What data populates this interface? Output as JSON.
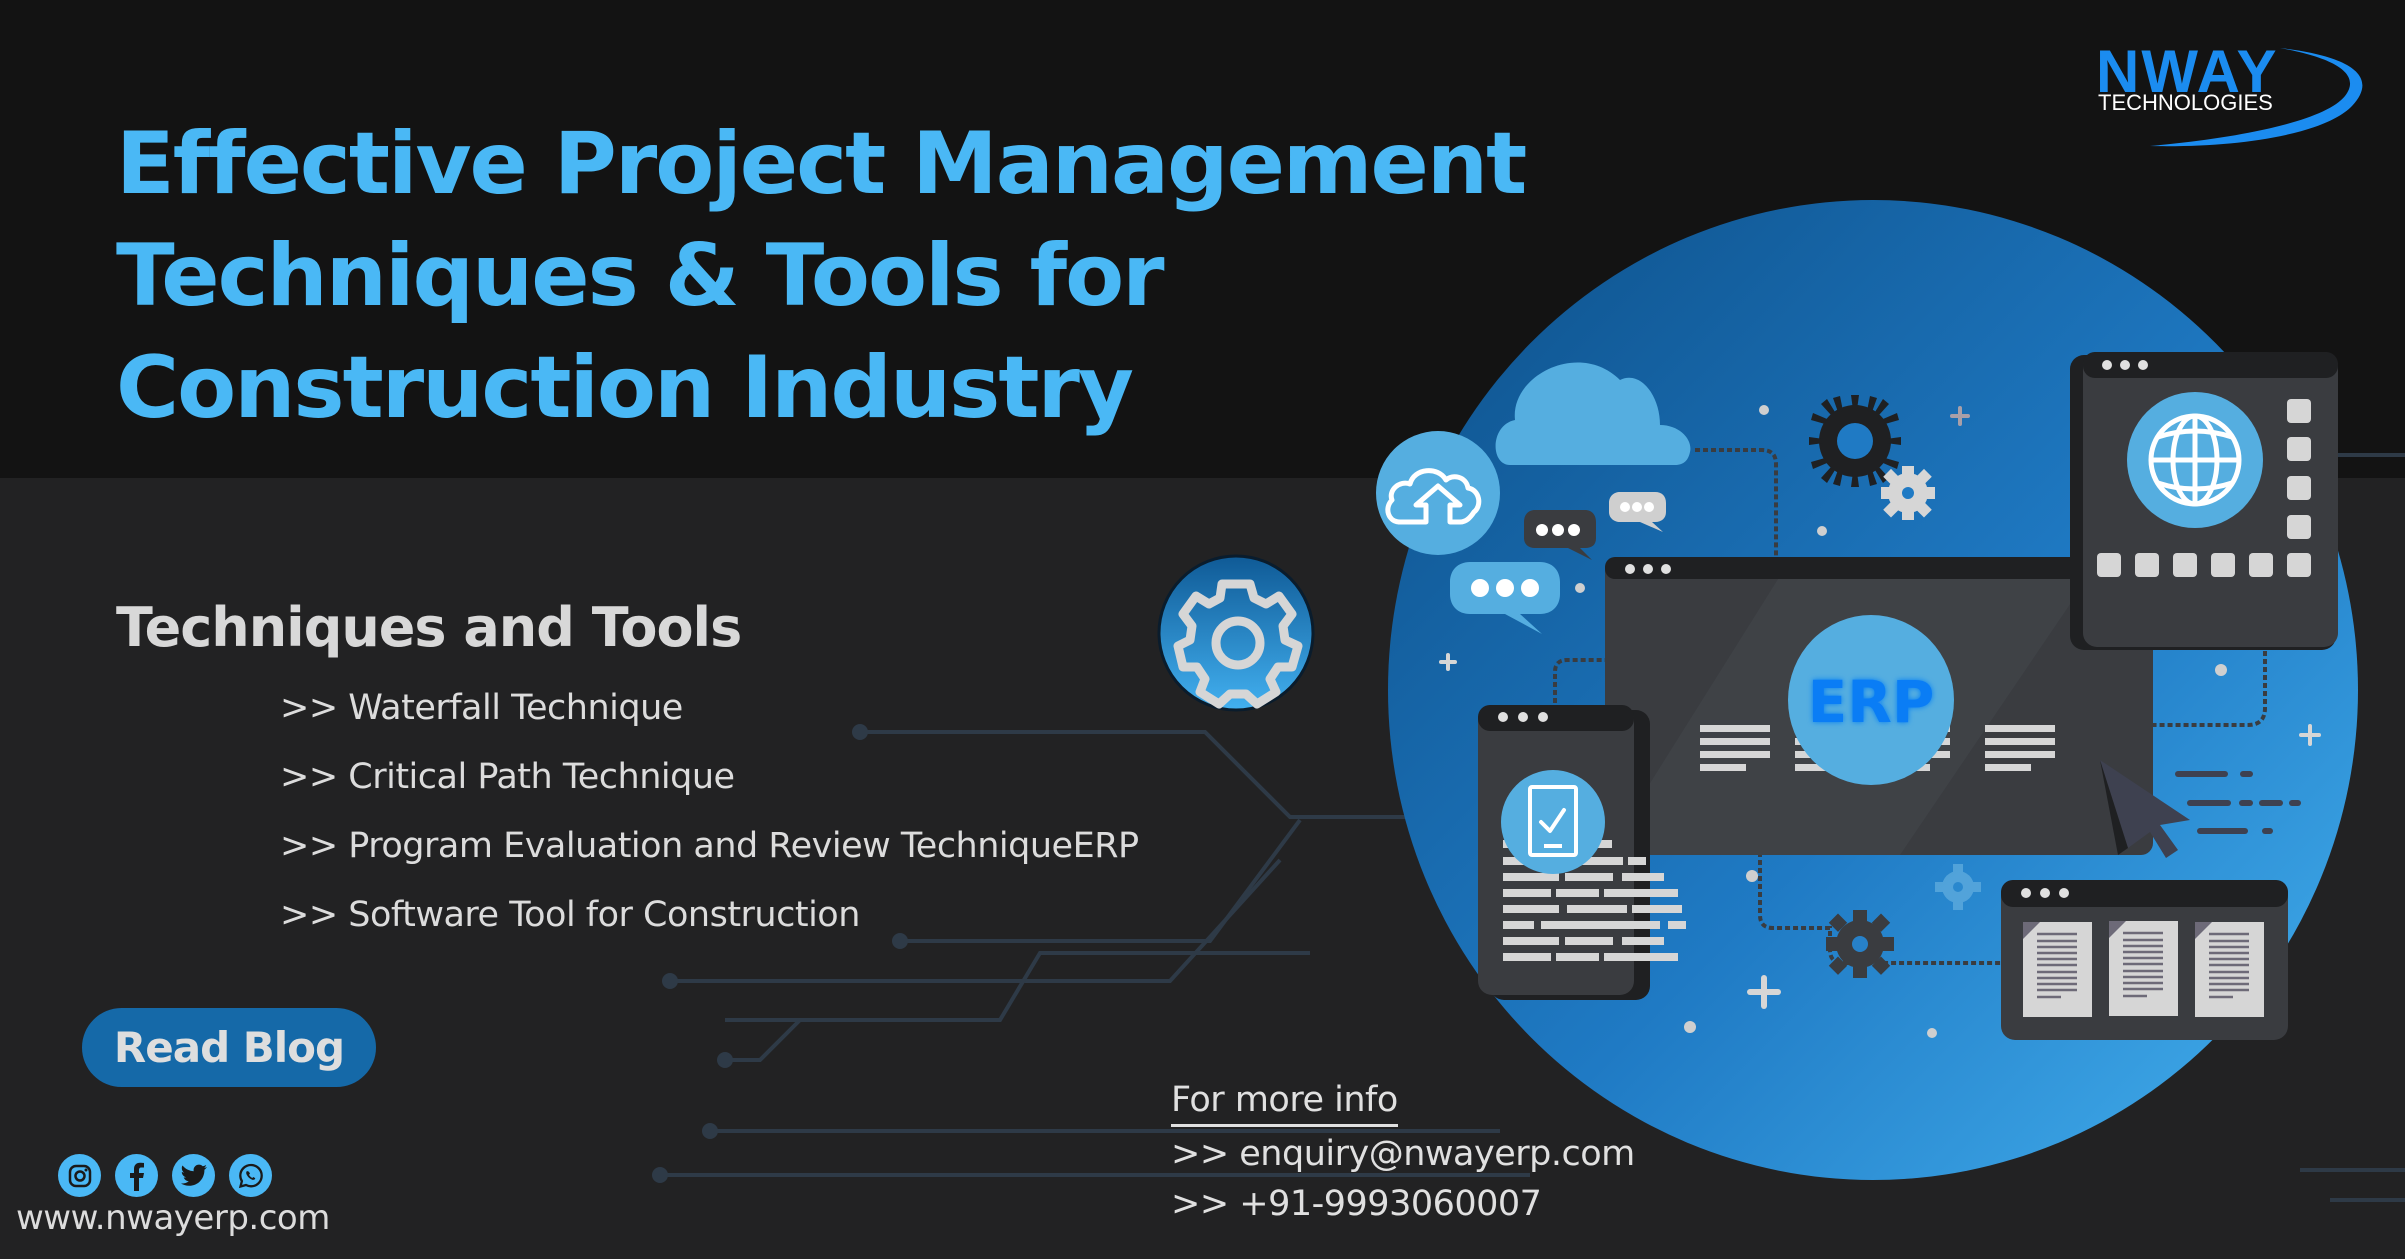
{
  "header": {
    "title_lines": [
      "Effective Project Management",
      "Techniques & Tools for",
      "Construction Industry"
    ]
  },
  "logo": {
    "brand": "NWAY",
    "subtitle": "TECHNOLOGIES"
  },
  "section": {
    "title": "Techniques and Tools",
    "items": [
      ">> Waterfall Technique",
      ">> Critical Path Technique",
      ">> Program Evaluation and Review TechniqueERP",
      ">> Software Tool for Construction"
    ]
  },
  "cta": {
    "read_blog_label": "Read Blog"
  },
  "social": {
    "icons": [
      "instagram-icon",
      "facebook-icon",
      "twitter-icon",
      "whatsapp-icon"
    ]
  },
  "footer": {
    "website": "www.nwayerp.com"
  },
  "contact": {
    "title": "For more info",
    "email": ">> enquiry@nwayerp.com",
    "phone": ">> +91-9993060007"
  },
  "illustration": {
    "center_label": "ERP"
  },
  "colors": {
    "accent": "#4ab8f5",
    "brand_blue": "#1b8cf0",
    "button": "#1569a8",
    "top_background": "#131313",
    "bottom_background": "#222223"
  }
}
